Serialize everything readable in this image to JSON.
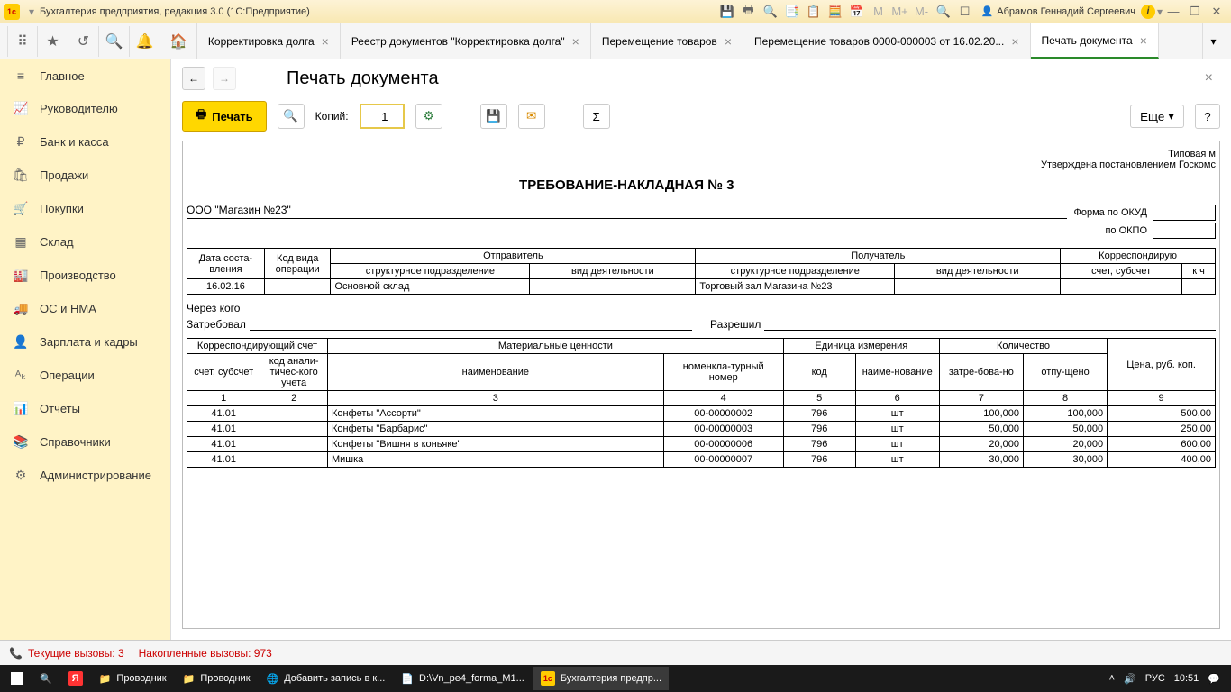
{
  "titlebar": {
    "title": "Бухгалтерия предприятия, редакция 3.0  (1С:Предприятие)",
    "user": "Абрамов Геннадий Сергеевич",
    "m_labels": [
      "M",
      "M+",
      "M-"
    ]
  },
  "tabs": [
    {
      "label": "Корректировка долга"
    },
    {
      "label": "Реестр документов \"Корректировка долга\""
    },
    {
      "label": "Перемещение товаров"
    },
    {
      "label": "Перемещение товаров 0000-000003 от 16.02.20..."
    },
    {
      "label": "Печать документа",
      "active": true
    }
  ],
  "sidebar": [
    {
      "icon": "≡",
      "label": "Главное"
    },
    {
      "icon": "📈",
      "label": "Руководителю"
    },
    {
      "icon": "₽",
      "label": "Банк и касса"
    },
    {
      "icon": "🛍",
      "label": "Продажи"
    },
    {
      "icon": "🛒",
      "label": "Покупки"
    },
    {
      "icon": "▦",
      "label": "Склад"
    },
    {
      "icon": "🏭",
      "label": "Производство"
    },
    {
      "icon": "🚚",
      "label": "ОС и НМА"
    },
    {
      "icon": "👤",
      "label": "Зарплата и кадры"
    },
    {
      "icon": "ᴬₖ",
      "label": "Операции"
    },
    {
      "icon": "📊",
      "label": "Отчеты"
    },
    {
      "icon": "📚",
      "label": "Справочники"
    },
    {
      "icon": "⚙",
      "label": "Администрирование"
    }
  ],
  "content": {
    "title": "Печать документа",
    "print_label": "Печать",
    "copies_label": "Копий:",
    "copies_value": "1",
    "more_label": "Еще"
  },
  "document": {
    "approval": "Типовая м",
    "approval2": "Утверждена постановлением Госкомс",
    "title": "ТРЕБОВАНИЕ-НАКЛАДНАЯ № 3",
    "okud_label": "Форма по ОКУД",
    "okpo_label": "по ОКПО",
    "org": "ООО \"Магазин №23\"",
    "via_label": "Через кого",
    "requested_label": "Затребовал",
    "approved_label": "Разрешил",
    "header1": {
      "date": "Дата соста-вления",
      "opcode": "Код вида операции",
      "sender": "Отправитель",
      "receiver": "Получатель",
      "corr": "Корреспондирую",
      "unit": "структурное подразделение",
      "activity": "вид деятельности",
      "account": "счет, субсчет",
      "k": "к ч"
    },
    "row1": {
      "date": "16.02.16",
      "sender_unit": "Основной склад",
      "receiver_unit": "Торговый зал Магазина №23"
    },
    "header2": {
      "corr_acc": "Корреспондирующий счет",
      "materials": "Материальные ценности",
      "unit_meas": "Единица измерения",
      "qty": "Количество",
      "price": "Цена, руб. коп.",
      "account": "счет, субсчет",
      "analytic": "код анали-тичес-кого учета",
      "name": "наименование",
      "nomenc": "номенкла-турный номер",
      "code": "код",
      "unit_name": "наиме-нование",
      "requested": "затре-бова-но",
      "released": "отпу-щено"
    },
    "colnums": [
      "1",
      "2",
      "3",
      "4",
      "5",
      "6",
      "7",
      "8",
      "9"
    ],
    "rows": [
      {
        "acc": "41.01",
        "name": "Конфеты \"Ассорти\"",
        "nom": "00-00000002",
        "code": "796",
        "unit": "шт",
        "req": "100,000",
        "rel": "100,000",
        "price": "500,00"
      },
      {
        "acc": "41.01",
        "name": "Конфеты \"Барбарис\"",
        "nom": "00-00000003",
        "code": "796",
        "unit": "шт",
        "req": "50,000",
        "rel": "50,000",
        "price": "250,00"
      },
      {
        "acc": "41.01",
        "name": "Конфеты \"Вишня в коньяке\"",
        "nom": "00-00000006",
        "code": "796",
        "unit": "шт",
        "req": "20,000",
        "rel": "20,000",
        "price": "600,00"
      },
      {
        "acc": "41.01",
        "name": "Мишка",
        "nom": "00-00000007",
        "code": "796",
        "unit": "шт",
        "req": "30,000",
        "rel": "30,000",
        "price": "400,00"
      }
    ]
  },
  "statusbar": {
    "text1": "Текущие вызовы: 3",
    "text2": "Накопленные вызовы: 973"
  },
  "taskbar": {
    "items": [
      {
        "icon": "⊞",
        "label": ""
      },
      {
        "icon": "🔍",
        "label": ""
      },
      {
        "icon": "Я",
        "label": "",
        "red": true
      },
      {
        "icon": "📁",
        "label": "Проводник"
      },
      {
        "icon": "📁",
        "label": "Проводник"
      },
      {
        "icon": "🌐",
        "label": "Добавить запись в к..."
      },
      {
        "icon": "📄",
        "label": "D:\\Vn_pe4_forma_M1..."
      },
      {
        "icon": "1c",
        "label": "Бухгалтерия предпр...",
        "active": true
      }
    ],
    "lang": "РУС",
    "time": "10:51"
  }
}
